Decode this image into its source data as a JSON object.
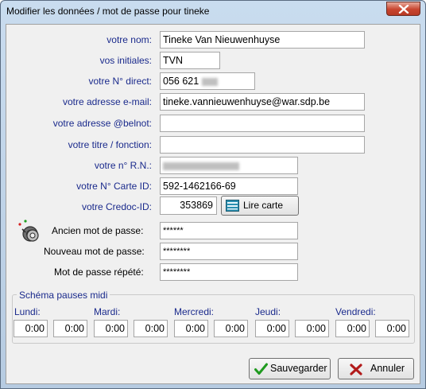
{
  "window": {
    "title": "Modifier les données / mot de passe pour tineke"
  },
  "form": {
    "nom": {
      "label": "votre nom:",
      "value": "Tineke Van Nieuwenhuyse"
    },
    "initiales": {
      "label": "vos initiales:",
      "value": "TVN"
    },
    "direct": {
      "label": "votre N° direct:",
      "value": "056 621"
    },
    "email": {
      "label": "votre adresse e-mail:",
      "value": "tineke.vannieuwenhuyse@war.sdp.be"
    },
    "belnot": {
      "label": "votre adresse @belnot:",
      "value": ""
    },
    "titre": {
      "label": "votre titre / fonction:",
      "value": ""
    },
    "rn": {
      "label": "votre n° R.N.:",
      "value": ""
    },
    "carte": {
      "label": "votre N° Carte ID:",
      "value": "592-1462166-69"
    },
    "credoc": {
      "label": "votre Credoc-ID:",
      "value": "353869"
    },
    "lire_carte_label": "Lire carte"
  },
  "password": {
    "ancien": {
      "label": "Ancien mot de passe:",
      "value": "******"
    },
    "nouveau": {
      "label": "Nouveau mot de passe:",
      "value": "********"
    },
    "repete": {
      "label": "Mot de passe répété:",
      "value": "********"
    }
  },
  "schedule": {
    "title": "Schéma pauses midi",
    "days": [
      {
        "name": "Lundi:",
        "from": "0:00",
        "to": "0:00"
      },
      {
        "name": "Mardi:",
        "from": "0:00",
        "to": "0:00"
      },
      {
        "name": "Mercredi:",
        "from": "0:00",
        "to": "0:00"
      },
      {
        "name": "Jeudi:",
        "from": "0:00",
        "to": "0:00"
      },
      {
        "name": "Vendredi:",
        "from": "0:00",
        "to": "0:00"
      }
    ]
  },
  "buttons": {
    "save_label": "Sauvegarder",
    "cancel_label": "Annuler"
  }
}
